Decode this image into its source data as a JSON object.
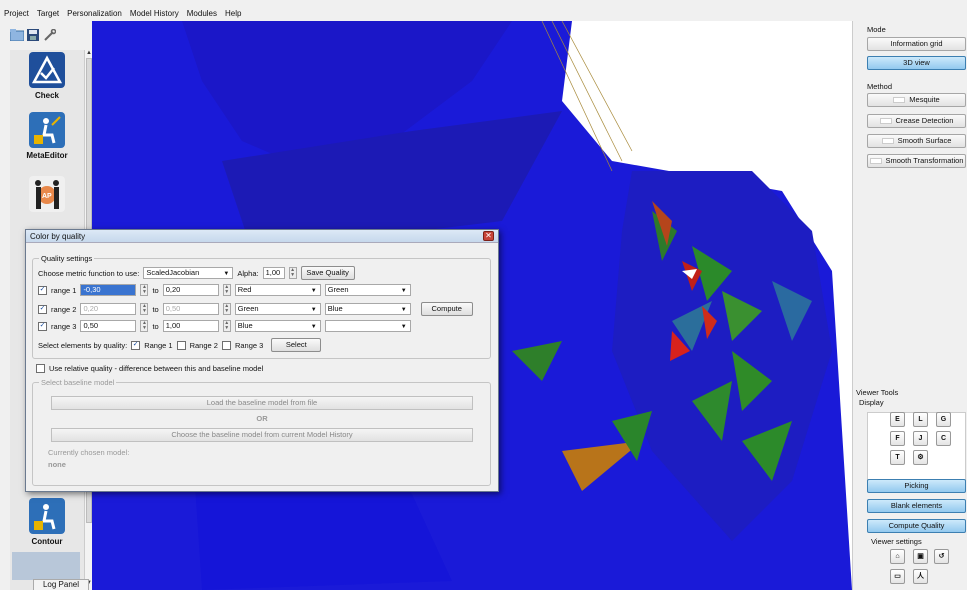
{
  "menu": [
    "Project",
    "Target",
    "Personalization",
    "Model History",
    "Modules",
    "Help"
  ],
  "toolbar": {
    "icons": [
      "open-folder-icon",
      "save-icon",
      "wrench-icon"
    ]
  },
  "modules": [
    {
      "label": "Check",
      "icon": "check-icon",
      "color": "#1f4f9b"
    },
    {
      "label": "MetaEditor",
      "icon": "meta-editor-icon",
      "color": "#2d6fb8"
    },
    {
      "label": "",
      "icon": "anthropometry-icon",
      "color": "#c4462c"
    },
    {
      "label": "Contour",
      "icon": "contour-icon",
      "color": "#2d6fb8"
    }
  ],
  "log_panel": "Log Panel",
  "right": {
    "mode_label": "Mode",
    "information_grid": "Information grid",
    "view_3d": "3D view",
    "method_label": "Method",
    "methods": [
      "Mesquite",
      "Crease Detection",
      "Smooth Surface",
      "Smooth Transformation"
    ],
    "viewer_tools": "Viewer Tools",
    "display": "Display",
    "display_buttons": [
      "E",
      "L",
      "G",
      "F",
      "J",
      "C",
      "T"
    ],
    "picking": "Picking",
    "blank_elements": "Blank elements",
    "compute_quality": "Compute Quality",
    "viewer_settings": "Viewer settings"
  },
  "dialog": {
    "title": "Color by quality",
    "quality_settings": "Quality settings",
    "choose_metric": "Choose metric function to use:",
    "metric": "ScaledJacobian",
    "alpha_label": "Alpha:",
    "alpha": "1,00",
    "save_quality": "Save Quality",
    "ranges": [
      {
        "label": "range 1",
        "from": "-0,30",
        "to": "0,20",
        "c1": "Red",
        "c2": "Green"
      },
      {
        "label": "range 2",
        "from": "0,20",
        "to": "0,50",
        "c1": "Green",
        "c2": "Blue"
      },
      {
        "label": "range 3",
        "from": "0,50",
        "to": "1,00",
        "c1": "Blue",
        "c2": ""
      }
    ],
    "to": "to",
    "compute": "Compute",
    "select_by_quality": "Select elements by quality:",
    "range_opts": [
      "Range 1",
      "Range 2",
      "Range 3"
    ],
    "select": "Select",
    "relative": "Use relative quality - difference between this and baseline model",
    "select_baseline": "Select baseline model",
    "load_baseline": "Load the baseline model from file",
    "or": "OR",
    "choose_baseline": "Choose the baseline model from current Model History",
    "currently_chosen": "Currently chosen model:",
    "none": "none"
  }
}
